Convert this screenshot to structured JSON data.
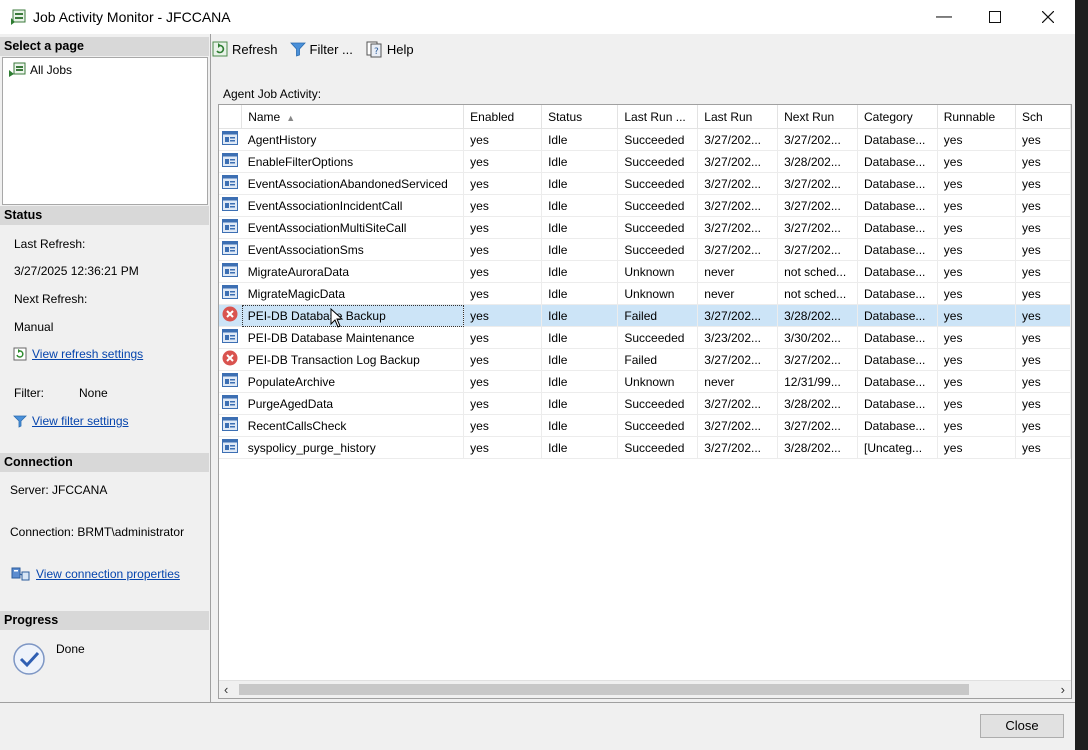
{
  "window": {
    "title": "Job Activity Monitor - JFCCANA"
  },
  "left": {
    "select_page_header": "Select a page",
    "pages": [
      {
        "label": "All Jobs",
        "icon": "jobs-icon"
      }
    ],
    "status_header": "Status",
    "last_refresh_label": "Last Refresh:",
    "last_refresh_value": "3/27/2025 12:36:21 PM",
    "next_refresh_label": "Next Refresh:",
    "next_refresh_value": "Manual",
    "view_refresh_link": "View refresh settings",
    "filter_label": "Filter:",
    "filter_value": "None",
    "view_filter_link": "View filter settings",
    "connection_header": "Connection",
    "server_text": "Server: JFCCANA",
    "connection_text": "Connection: BRMT\\administrator",
    "view_connection_link": "View connection properties",
    "progress_header": "Progress",
    "progress_text": "Done"
  },
  "toolbar": {
    "refresh": "Refresh",
    "filter": "Filter ...",
    "help": "Help"
  },
  "grid": {
    "label": "Agent Job Activity:",
    "columns": [
      "",
      "Name",
      "Enabled",
      "Status",
      "Last Run ...",
      "Last Run",
      "Next Run",
      "Category",
      "Runnable",
      "Sch"
    ],
    "rows": [
      {
        "icon": "job",
        "cells": [
          "AgentHistory",
          "yes",
          "Idle",
          "Succeeded",
          "3/27/202...",
          "3/27/202...",
          "Database...",
          "yes",
          "yes"
        ]
      },
      {
        "icon": "job",
        "cells": [
          "EnableFilterOptions",
          "yes",
          "Idle",
          "Succeeded",
          "3/27/202...",
          "3/28/202...",
          "Database...",
          "yes",
          "yes"
        ]
      },
      {
        "icon": "job",
        "cells": [
          "EventAssociationAbandonedServiced",
          "yes",
          "Idle",
          "Succeeded",
          "3/27/202...",
          "3/27/202...",
          "Database...",
          "yes",
          "yes"
        ]
      },
      {
        "icon": "job",
        "cells": [
          "EventAssociationIncidentCall",
          "yes",
          "Idle",
          "Succeeded",
          "3/27/202...",
          "3/27/202...",
          "Database...",
          "yes",
          "yes"
        ]
      },
      {
        "icon": "job",
        "cells": [
          "EventAssociationMultiSiteCall",
          "yes",
          "Idle",
          "Succeeded",
          "3/27/202...",
          "3/27/202...",
          "Database...",
          "yes",
          "yes"
        ]
      },
      {
        "icon": "job",
        "cells": [
          "EventAssociationSms",
          "yes",
          "Idle",
          "Succeeded",
          "3/27/202...",
          "3/27/202...",
          "Database...",
          "yes",
          "yes"
        ]
      },
      {
        "icon": "job",
        "cells": [
          "MigrateAuroraData",
          "yes",
          "Idle",
          "Unknown",
          "never",
          "not sched...",
          "Database...",
          "yes",
          "yes"
        ]
      },
      {
        "icon": "job",
        "cells": [
          "MigrateMagicData",
          "yes",
          "Idle",
          "Unknown",
          "never",
          "not sched...",
          "Database...",
          "yes",
          "yes"
        ]
      },
      {
        "icon": "failed",
        "selected": true,
        "cells": [
          "PEI-DB Database Backup",
          "yes",
          "Idle",
          "Failed",
          "3/27/202...",
          "3/28/202...",
          "Database...",
          "yes",
          "yes"
        ]
      },
      {
        "icon": "job",
        "cells": [
          "PEI-DB Database Maintenance",
          "yes",
          "Idle",
          "Succeeded",
          "3/23/202...",
          "3/30/202...",
          "Database...",
          "yes",
          "yes"
        ]
      },
      {
        "icon": "failed",
        "cells": [
          "PEI-DB Transaction Log Backup",
          "yes",
          "Idle",
          "Failed",
          "3/27/202...",
          "3/27/202...",
          "Database...",
          "yes",
          "yes"
        ]
      },
      {
        "icon": "job",
        "cells": [
          "PopulateArchive",
          "yes",
          "Idle",
          "Unknown",
          "never",
          "12/31/99...",
          "Database...",
          "yes",
          "yes"
        ]
      },
      {
        "icon": "job",
        "cells": [
          "PurgeAgedData",
          "yes",
          "Idle",
          "Succeeded",
          "3/27/202...",
          "3/28/202...",
          "Database...",
          "yes",
          "yes"
        ]
      },
      {
        "icon": "job",
        "cells": [
          "RecentCallsCheck",
          "yes",
          "Idle",
          "Succeeded",
          "3/27/202...",
          "3/27/202...",
          "Database...",
          "yes",
          "yes"
        ]
      },
      {
        "icon": "job",
        "cells": [
          "syspolicy_purge_history",
          "yes",
          "Idle",
          "Succeeded",
          "3/27/202...",
          "3/28/202...",
          "[Uncateg...",
          "yes",
          "yes"
        ]
      }
    ]
  },
  "footer": {
    "close": "Close"
  }
}
